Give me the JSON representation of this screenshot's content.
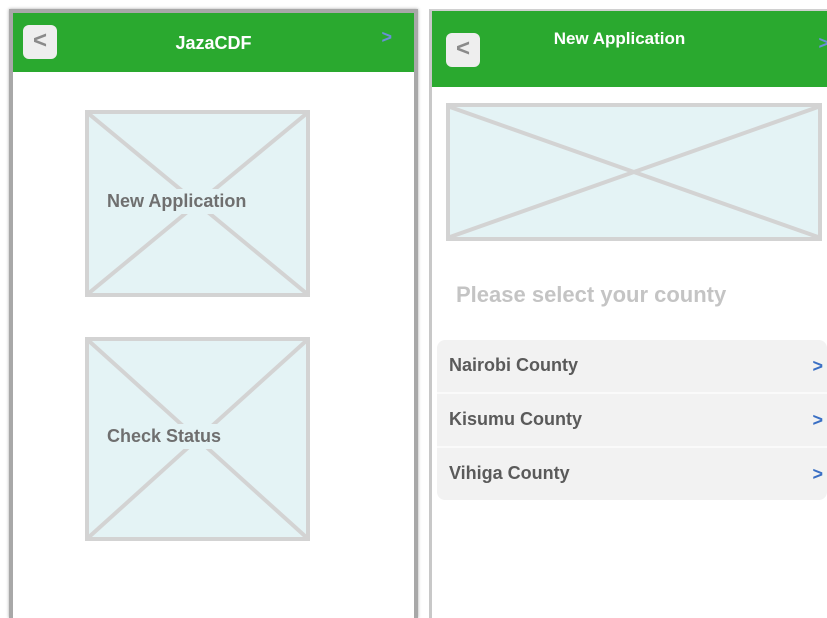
{
  "screen_home": {
    "back_label": "<",
    "title": "JazaCDF",
    "forward_label": ">",
    "tiles": [
      {
        "label": "New Application"
      },
      {
        "label": "Check Status"
      }
    ]
  },
  "screen_new_application": {
    "back_label": "<",
    "title": "New Application",
    "forward_label": ">",
    "prompt": "Please select your county",
    "counties": [
      {
        "label": "Nairobi County",
        "chevron": ">"
      },
      {
        "label": "Kisumu County",
        "chevron": ">"
      },
      {
        "label": "Vihiga County",
        "chevron": ">"
      }
    ]
  },
  "colors": {
    "header_green": "#2aa92f",
    "chevron_blue": "#3a6fc4",
    "placeholder_fill": "#e4f3f5",
    "placeholder_stroke": "#d3d3d3"
  }
}
